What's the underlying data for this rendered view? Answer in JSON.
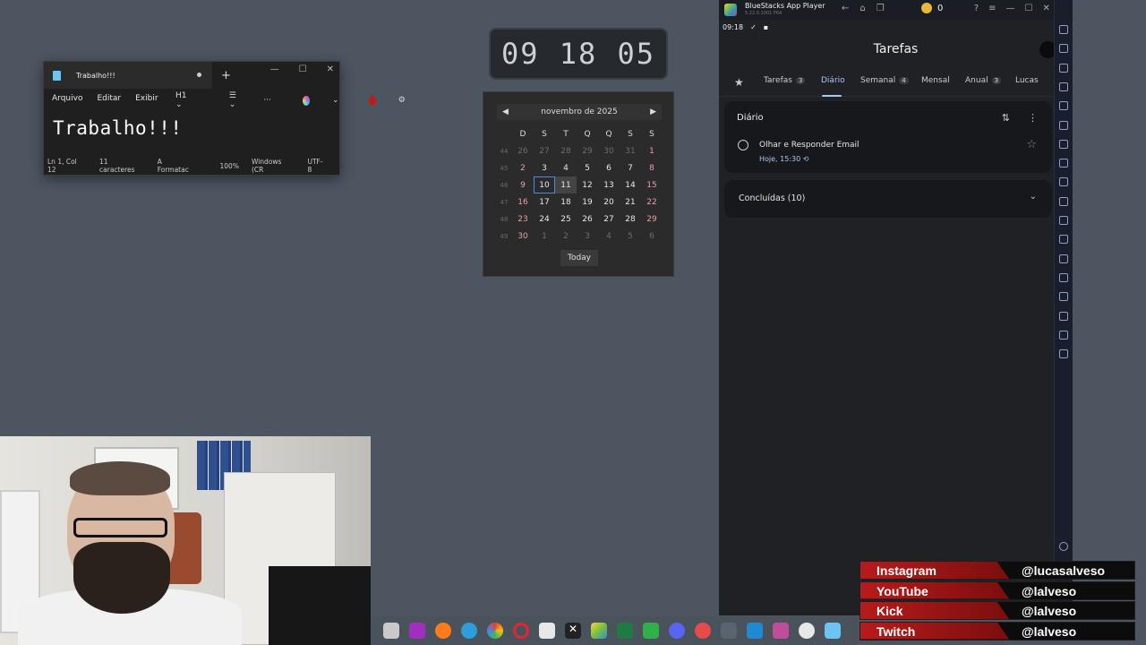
{
  "notepad": {
    "tab_title": "Trabalho!!!",
    "add_tab": "+",
    "menu": [
      "Arquivo",
      "Editar",
      "Exibir"
    ],
    "heading_select": "H1",
    "more": "···",
    "content": "Trabalho!!!",
    "status": {
      "position": "Ln 1, Col 12",
      "chars": "11 caracteres",
      "format": "Formatac",
      "zoom": "100%",
      "line_ending": "Windows (CR",
      "encoding": "UTF-8"
    }
  },
  "clock": {
    "hours": "09",
    "minutes": "18",
    "seconds": "05"
  },
  "calendar": {
    "month_label": "novembro de 2025",
    "weekdays": [
      "D",
      "S",
      "T",
      "Q",
      "Q",
      "S",
      "S"
    ],
    "weeks": [
      {
        "num": "44",
        "days": [
          "26",
          "27",
          "28",
          "29",
          "30",
          "31",
          "1"
        ]
      },
      {
        "num": "45",
        "days": [
          "2",
          "3",
          "4",
          "5",
          "6",
          "7",
          "8"
        ]
      },
      {
        "num": "46",
        "days": [
          "9",
          "10",
          "11",
          "12",
          "13",
          "14",
          "15"
        ]
      },
      {
        "num": "47",
        "days": [
          "16",
          "17",
          "18",
          "19",
          "20",
          "21",
          "22"
        ]
      },
      {
        "num": "48",
        "days": [
          "23",
          "24",
          "25",
          "26",
          "27",
          "28",
          "29"
        ]
      },
      {
        "num": "49",
        "days": [
          "30",
          "1",
          "2",
          "3",
          "4",
          "5",
          "6"
        ]
      }
    ],
    "selected_day": "10",
    "today_day": "11",
    "today_button": "Today"
  },
  "bluestacks": {
    "title": "BlueStacks App Player",
    "version": "5.22.0.1001 P64",
    "coins": "0",
    "status_time": "09:18",
    "app": {
      "title": "Tarefas",
      "tabs": [
        {
          "label": "Tarefas",
          "count": "3"
        },
        {
          "label": "Diário",
          "count": ""
        },
        {
          "label": "Semanal",
          "count": "4"
        },
        {
          "label": "Mensal",
          "count": ""
        },
        {
          "label": "Anual",
          "count": "3"
        },
        {
          "label": "Lucas",
          "count": ""
        }
      ],
      "active_tab": "Diário",
      "list_title": "Diário",
      "task": {
        "title": "Olhar e Responder Email",
        "due": "Hoje, 15:30"
      },
      "completed_label": "Concluídas (10)"
    }
  },
  "social": [
    {
      "name": "Instagram",
      "handle": "@lucasalveso"
    },
    {
      "name": "YouTube",
      "handle": "@lalveso"
    },
    {
      "name": "Kick",
      "handle": "@lalveso"
    },
    {
      "name": "Twitch",
      "handle": "@lalveso"
    }
  ],
  "colors": {
    "desktop": "#4d5561",
    "accent_blue": "#a8c7fa",
    "social_red": "#b71b1b"
  }
}
